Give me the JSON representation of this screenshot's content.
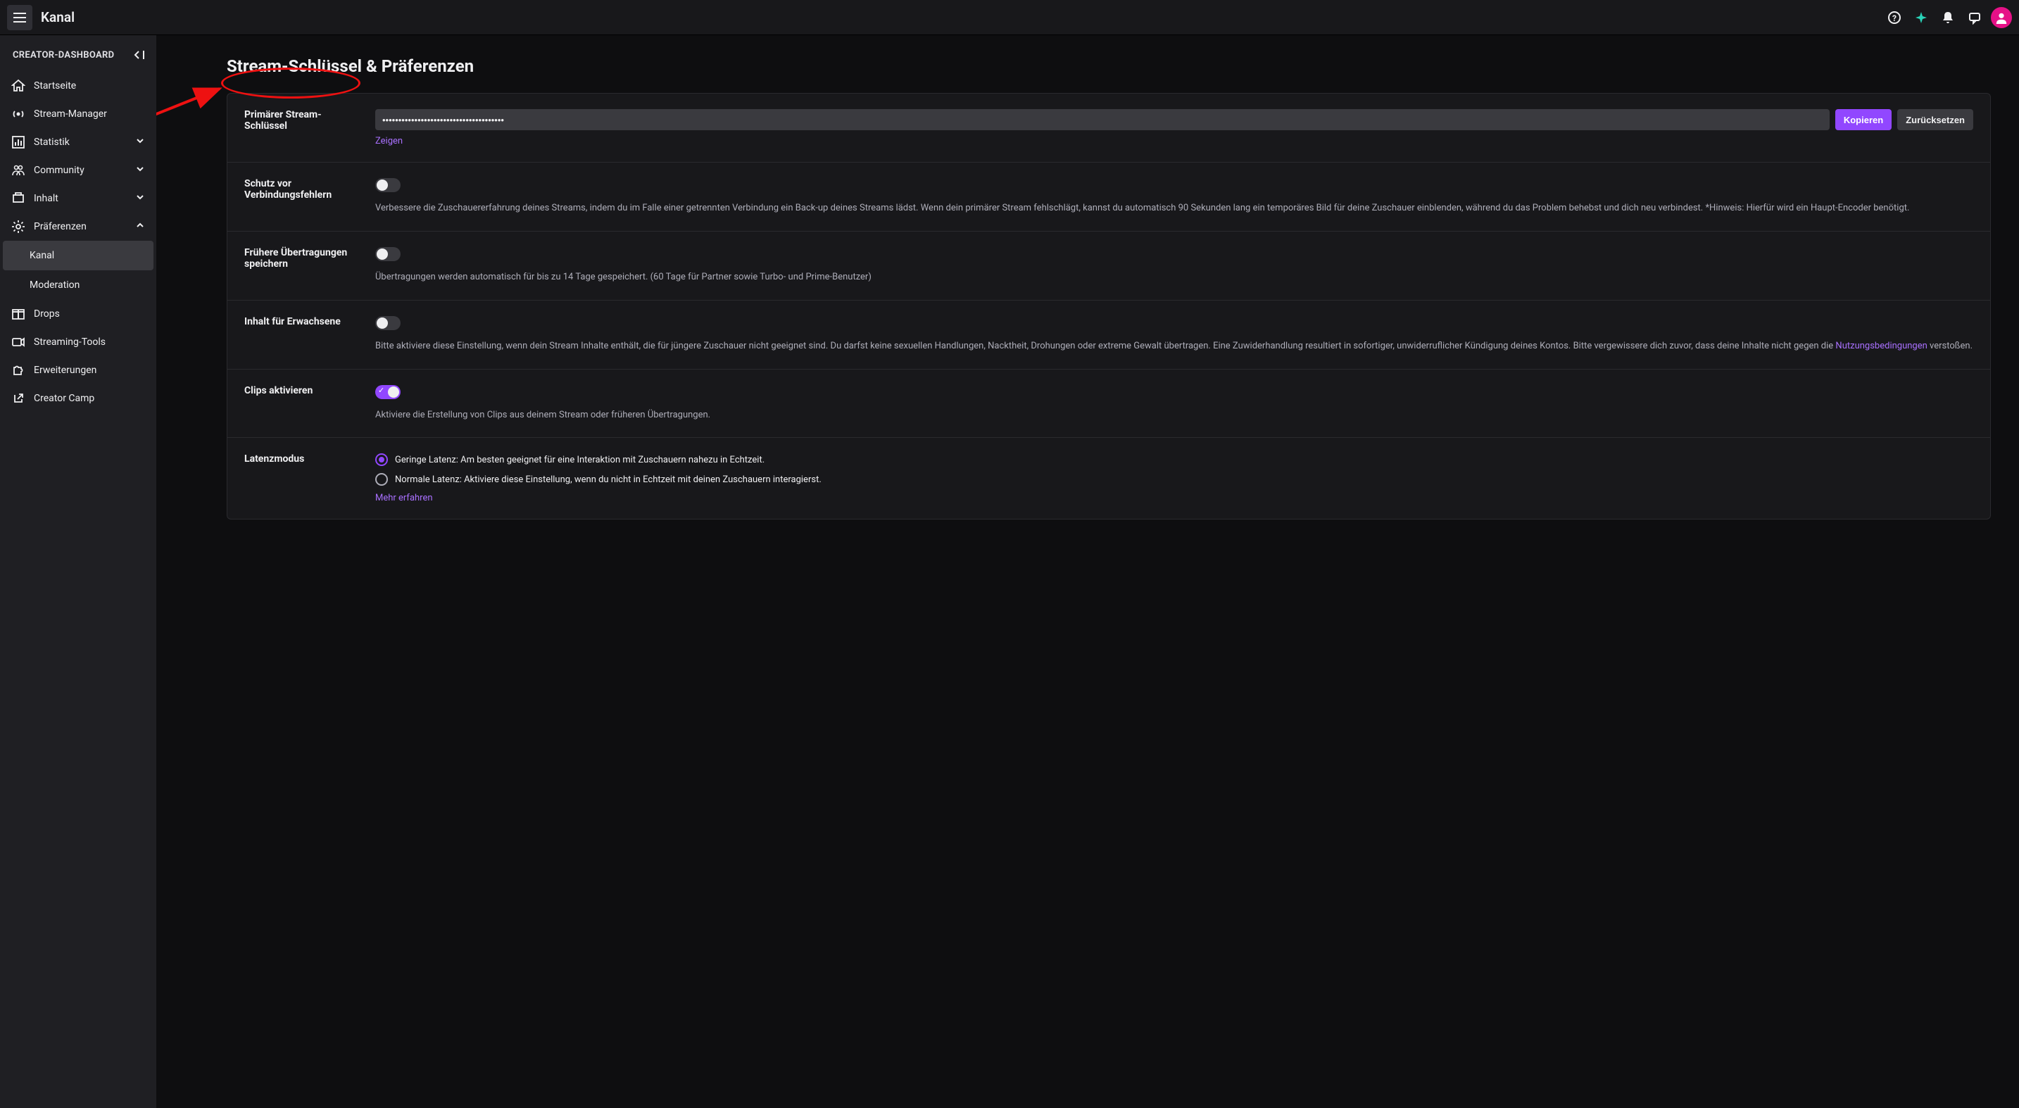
{
  "topbar": {
    "title": "Kanal"
  },
  "sidebar": {
    "header": "CREATOR-DASHBOARD",
    "items": [
      {
        "label": "Startseite",
        "icon": "home",
        "expandable": false
      },
      {
        "label": "Stream-Manager",
        "icon": "broadcast",
        "expandable": false
      },
      {
        "label": "Statistik",
        "icon": "stats",
        "expandable": true,
        "expanded": false
      },
      {
        "label": "Community",
        "icon": "community",
        "expandable": true,
        "expanded": false
      },
      {
        "label": "Inhalt",
        "icon": "content",
        "expandable": true,
        "expanded": false
      },
      {
        "label": "Präferenzen",
        "icon": "gear",
        "expandable": true,
        "expanded": true,
        "subitems": [
          {
            "label": "Kanal",
            "active": true
          },
          {
            "label": "Moderation",
            "active": false
          }
        ]
      },
      {
        "label": "Drops",
        "icon": "drops",
        "expandable": false
      },
      {
        "label": "Streaming-Tools",
        "icon": "tools",
        "expandable": false
      },
      {
        "label": "Erweiterungen",
        "icon": "extensions",
        "expandable": false
      },
      {
        "label": "Creator Camp",
        "icon": "external",
        "expandable": false
      }
    ]
  },
  "page": {
    "title": "Stream-Schlüssel & Präferenzen"
  },
  "streamKey": {
    "label": "Primärer Stream-Schlüssel",
    "value": "••••••••••••••••••••••••••••••••••••••",
    "copy": "Kopieren",
    "reset": "Zurücksetzen",
    "show": "Zeigen"
  },
  "settings": {
    "disconnect": {
      "label": "Schutz vor Verbindungsfehlern",
      "on": false,
      "desc": "Verbessere die Zuschauererfahrung deines Streams, indem du im Falle einer getrennten Verbindung ein Back-up deines Streams lädst. Wenn dein primärer Stream fehlschlägt, kannst du automatisch 90 Sekunden lang ein temporäres Bild für deine Zuschauer einblenden, während du das Problem behebst und dich neu verbindest. *Hinweis: Hierfür wird ein Haupt-Encoder benötigt."
    },
    "vod": {
      "label": "Frühere Übertragungen speichern",
      "on": false,
      "desc": "Übertragungen werden automatisch für bis zu 14 Tage gespeichert. (60 Tage für Partner sowie Turbo- und Prime-Benutzer)"
    },
    "mature": {
      "label": "Inhalt für Erwachsene",
      "on": false,
      "desc_before": "Bitte aktiviere diese Einstellung, wenn dein Stream Inhalte enthält, die für jüngere Zuschauer nicht geeignet sind. Du darfst keine sexuellen Handlungen, Nacktheit, Drohungen oder extreme Gewalt übertragen. Eine Zuwiderhandlung resultiert in sofortiger, unwiderruflicher Kündigung deines Kontos. Bitte vergewissere dich zuvor, dass deine Inhalte nicht gegen die ",
      "tos_link": "Nutzungsbedingungen",
      "desc_after": " verstoßen."
    },
    "clips": {
      "label": "Clips aktivieren",
      "on": true,
      "desc": "Aktiviere die Erstellung von Clips aus deinem Stream oder früheren Übertragungen."
    },
    "latency": {
      "label": "Latenzmodus",
      "low": "Geringe Latenz: Am besten geeignet für eine Interaktion mit Zuschauern nahezu in Echtzeit.",
      "normal": "Normale Latenz: Aktiviere diese Einstellung, wenn du nicht in Echtzeit mit deinen Zuschauern interagierst.",
      "learn_more": "Mehr erfahren"
    }
  }
}
